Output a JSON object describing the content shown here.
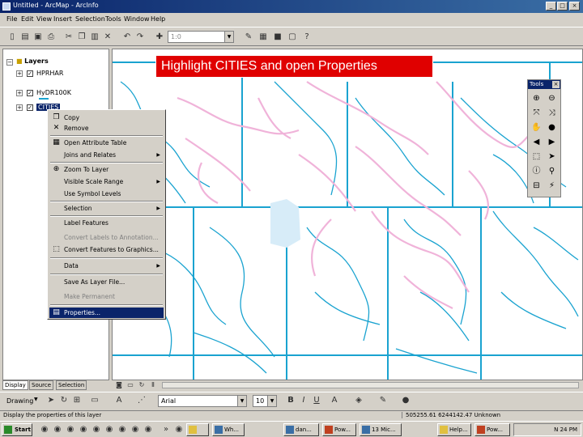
{
  "window": {
    "title": "Untitled - ArcMap - ArcInfo"
  },
  "menu": [
    "File",
    "Edit",
    "View",
    "Insert",
    "Selection",
    "Tools",
    "Window",
    "Help"
  ],
  "toolbar": {
    "scale_value": "1:0"
  },
  "toc": {
    "root_label": "Layers",
    "layers": [
      {
        "label": "HPRHAR"
      },
      {
        "label": "HyDR100K"
      },
      {
        "label": "CITIES"
      }
    ],
    "tabs": [
      "Display",
      "Source",
      "Selection"
    ]
  },
  "banner": {
    "text": "Highlight CITIES and open Properties"
  },
  "context_menu": {
    "items": [
      {
        "label": "Copy",
        "icon": "copy-icon"
      },
      {
        "label": "Remove",
        "icon": "remove-icon"
      },
      {
        "label": "Open Attribute Table",
        "icon": "table-icon"
      },
      {
        "label": "Joins and Relates"
      },
      {
        "label": "Zoom To Layer",
        "icon": "zoom-icon"
      },
      {
        "label": "Visible Scale Range"
      },
      {
        "label": "Use Symbol Levels"
      },
      {
        "label": "Selection"
      },
      {
        "label": "Label Features"
      },
      {
        "label": "Convert Labels to Annotation..."
      },
      {
        "label": "Convert Features to Graphics..."
      },
      {
        "label": "Data"
      },
      {
        "label": "Save As Layer File..."
      },
      {
        "label": "Make Permanent"
      },
      {
        "label": "Properties..."
      }
    ]
  },
  "tools": {
    "title": "Tools"
  },
  "drawing": {
    "label": "Drawing",
    "font": "Arial",
    "size": "10"
  },
  "status": {
    "message": "Display the properties of this layer",
    "coords": "505255.61  6244142.47 Unknown"
  },
  "taskbar": {
    "start": "Start",
    "tasks": [
      "Wh...",
      "dan...",
      "Pow...",
      "13 Mic...",
      "Help...",
      "Pow..."
    ],
    "clock": "N 24 PM"
  },
  "colors": {
    "banner": "#e00000",
    "rivers": "#1aa3d0",
    "cities": "#f0b3d9",
    "selection": "#0a246a"
  }
}
